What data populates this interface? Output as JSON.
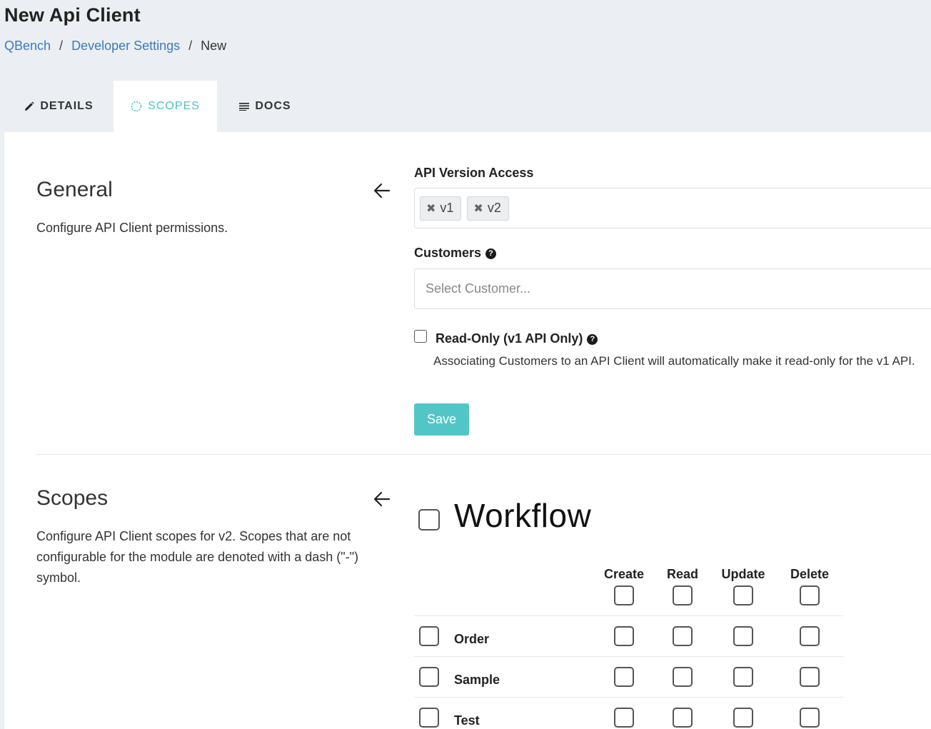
{
  "page": {
    "title": "New Api Client"
  },
  "breadcrumb": {
    "items": [
      "QBench",
      "Developer Settings",
      "New"
    ],
    "separator": "/"
  },
  "tabs": [
    {
      "label": "DETAILS",
      "icon": "pencil-icon",
      "active": false
    },
    {
      "label": "SCOPES",
      "icon": "circle-dashed-icon",
      "active": true
    },
    {
      "label": "DOCS",
      "icon": "list-icon",
      "active": false
    }
  ],
  "general": {
    "title": "General",
    "description": "Configure API Client permissions.",
    "api_version_label": "API Version Access",
    "api_versions": [
      "v1",
      "v2"
    ],
    "customers_label": "Customers",
    "customers_placeholder": "Select Customer...",
    "readonly_label": "Read-Only (v1 API Only)",
    "readonly_checked": false,
    "note": "Associating Customers to an API Client will automatically make it read-only for the v1 API.",
    "save_label": "Save"
  },
  "scopes": {
    "title": "Scopes",
    "description": "Configure API Client scopes for v2. Scopes that are not configurable for the module are denoted with a dash (\"-\") symbol.",
    "group_title": "Workflow",
    "columns": [
      "Create",
      "Read",
      "Update",
      "Delete"
    ],
    "rows": [
      "Order",
      "Sample",
      "Test"
    ]
  },
  "colors": {
    "accent": "#52c6c6",
    "link": "#3a7bbf",
    "background": "#ebeef2"
  }
}
